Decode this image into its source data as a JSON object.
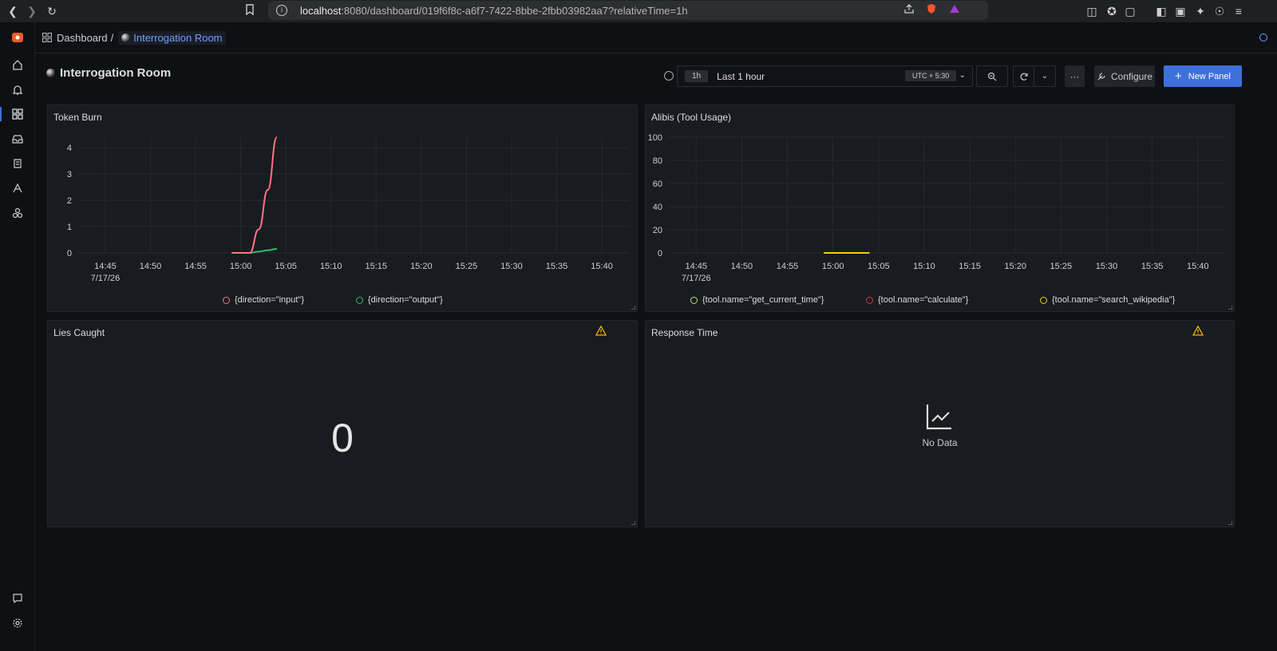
{
  "browser": {
    "url_host": "localhost",
    "url_rest": ":8080/dashboard/019f6f8c-a6f7-7422-8bbe-2fbb03982aa7?relativeTime=1h"
  },
  "breadcrumb": {
    "parent": "Dashboard",
    "separator": "/",
    "current": "Interrogation Room"
  },
  "dashboard": {
    "title": "Interrogation Room"
  },
  "toolbar": {
    "time_badge": "1h",
    "time_label": "Last 1 hour",
    "timezone": "UTC + 5:30",
    "more_label": "···",
    "configure_label": "Configure",
    "new_panel_label": "New Panel"
  },
  "colors": {
    "accent": "#3d71d9",
    "input": "#ff7383",
    "output": "#3cb86a",
    "calculate": "#e02f44",
    "get_current_time": "#b3e36a",
    "search_wikipedia": "#f2cc0c",
    "warning": "#f2b705"
  },
  "panels": {
    "token_burn": {
      "title": "Token Burn",
      "legend": [
        "{direction=\"input\"}",
        "{direction=\"output\"}"
      ]
    },
    "alibis": {
      "title": "Alibis (Tool Usage)",
      "legend": [
        "{tool.name=\"get_current_time\"}",
        "{tool.name=\"calculate\"}",
        "{tool.name=\"search_wikipedia\"}"
      ]
    },
    "lies": {
      "title": "Lies Caught",
      "value": "0"
    },
    "response": {
      "title": "Response Time",
      "no_data": "No Data"
    }
  },
  "chart_data": [
    {
      "type": "line",
      "title": "Token Burn",
      "x_ticks": [
        "14:45",
        "14:50",
        "14:55",
        "15:00",
        "15:05",
        "15:10",
        "15:15",
        "15:20",
        "15:25",
        "15:30",
        "15:35",
        "15:40"
      ],
      "x_date_label": "7/17/26",
      "y_ticks": [
        "0",
        "1",
        "2",
        "3",
        "4"
      ],
      "ylim": [
        0,
        4.4
      ],
      "series": [
        {
          "name": "{direction=\"input\"}",
          "x": [
            "14:59",
            "15:01",
            "15:02",
            "15:03",
            "15:04"
          ],
          "values": [
            0,
            0,
            0.9,
            2.4,
            4.4
          ]
        },
        {
          "name": "{direction=\"output\"}",
          "x": [
            "14:59",
            "15:01",
            "15:02",
            "15:03",
            "15:04"
          ],
          "values": [
            0,
            0,
            0.05,
            0.1,
            0.15
          ]
        }
      ],
      "legend_position": "bottom"
    },
    {
      "type": "line",
      "title": "Alibis (Tool Usage)",
      "x_ticks": [
        "14:45",
        "14:50",
        "14:55",
        "15:00",
        "15:05",
        "15:10",
        "15:15",
        "15:20",
        "15:25",
        "15:30",
        "15:35",
        "15:40"
      ],
      "x_date_label": "7/17/26",
      "y_ticks": [
        "0",
        "20",
        "40",
        "60",
        "80",
        "100"
      ],
      "ylim": [
        0,
        100
      ],
      "series": [
        {
          "name": "{tool.name=\"get_current_time\"}",
          "x": [
            "14:59",
            "15:04"
          ],
          "values": [
            0,
            0
          ]
        },
        {
          "name": "{tool.name=\"calculate\"}",
          "x": [
            "14:59",
            "15:04"
          ],
          "values": [
            0,
            0
          ]
        },
        {
          "name": "{tool.name=\"search_wikipedia\"}",
          "x": [
            "14:59",
            "15:04"
          ],
          "values": [
            0,
            0
          ]
        }
      ],
      "legend_position": "bottom"
    }
  ]
}
